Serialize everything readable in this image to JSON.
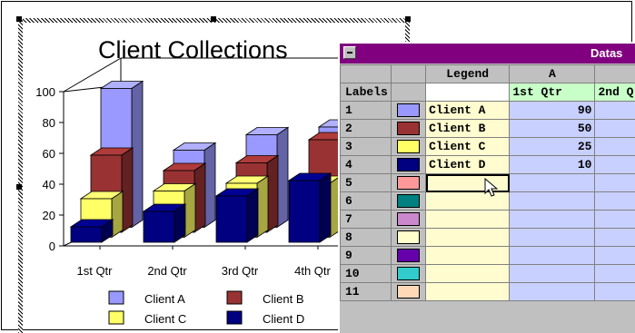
{
  "chart": {
    "title": "Client Collections",
    "legend": [
      "Client A",
      "Client B",
      "Client C",
      "Client D"
    ]
  },
  "chart_data": {
    "type": "bar",
    "subtype": "3d-column",
    "title": "Client Collections",
    "categories": [
      "1st Qtr",
      "2nd Qtr",
      "3rd Qtr",
      "4th Qtr"
    ],
    "series": [
      {
        "name": "Client A",
        "color": "#9999ff",
        "values": [
          90,
          50,
          60,
          65
        ]
      },
      {
        "name": "Client B",
        "color": "#993333",
        "values": [
          50,
          40,
          45,
          60
        ]
      },
      {
        "name": "Client C",
        "color": "#ffff66",
        "values": [
          25,
          30,
          35,
          35
        ]
      },
      {
        "name": "Client D",
        "color": "#000080",
        "values": [
          10,
          20,
          30,
          40
        ]
      }
    ],
    "ylim": [
      0,
      100
    ],
    "yticks": [
      "0",
      "20",
      "40",
      "60",
      "80",
      "100"
    ],
    "grid": false,
    "legend_position": "bottom"
  },
  "datasheet": {
    "title": "Datas",
    "headers": {
      "legend": "Legend",
      "colA": "A",
      "labels": "Labels",
      "q1": "1st Qtr",
      "q2": "2nd Q"
    },
    "rows": [
      {
        "num": "1",
        "color": "#9999ff",
        "label": "Client A",
        "a": "90"
      },
      {
        "num": "2",
        "color": "#993333",
        "label": "Client B",
        "a": "50"
      },
      {
        "num": "3",
        "color": "#ffff66",
        "label": "Client C",
        "a": "25"
      },
      {
        "num": "4",
        "color": "#000080",
        "label": "Client D",
        "a": "10"
      },
      {
        "num": "5",
        "color": "#ff9999",
        "label": "",
        "a": ""
      },
      {
        "num": "6",
        "color": "#008080",
        "label": "",
        "a": ""
      },
      {
        "num": "7",
        "color": "#cc88cc",
        "label": "",
        "a": ""
      },
      {
        "num": "8",
        "color": "#ffffcc",
        "label": "",
        "a": ""
      },
      {
        "num": "9",
        "color": "#6600aa",
        "label": "",
        "a": ""
      },
      {
        "num": "10",
        "color": "#33cccc",
        "label": "",
        "a": ""
      },
      {
        "num": "11",
        "color": "#ffd8b8",
        "label": "",
        "a": ""
      }
    ]
  }
}
